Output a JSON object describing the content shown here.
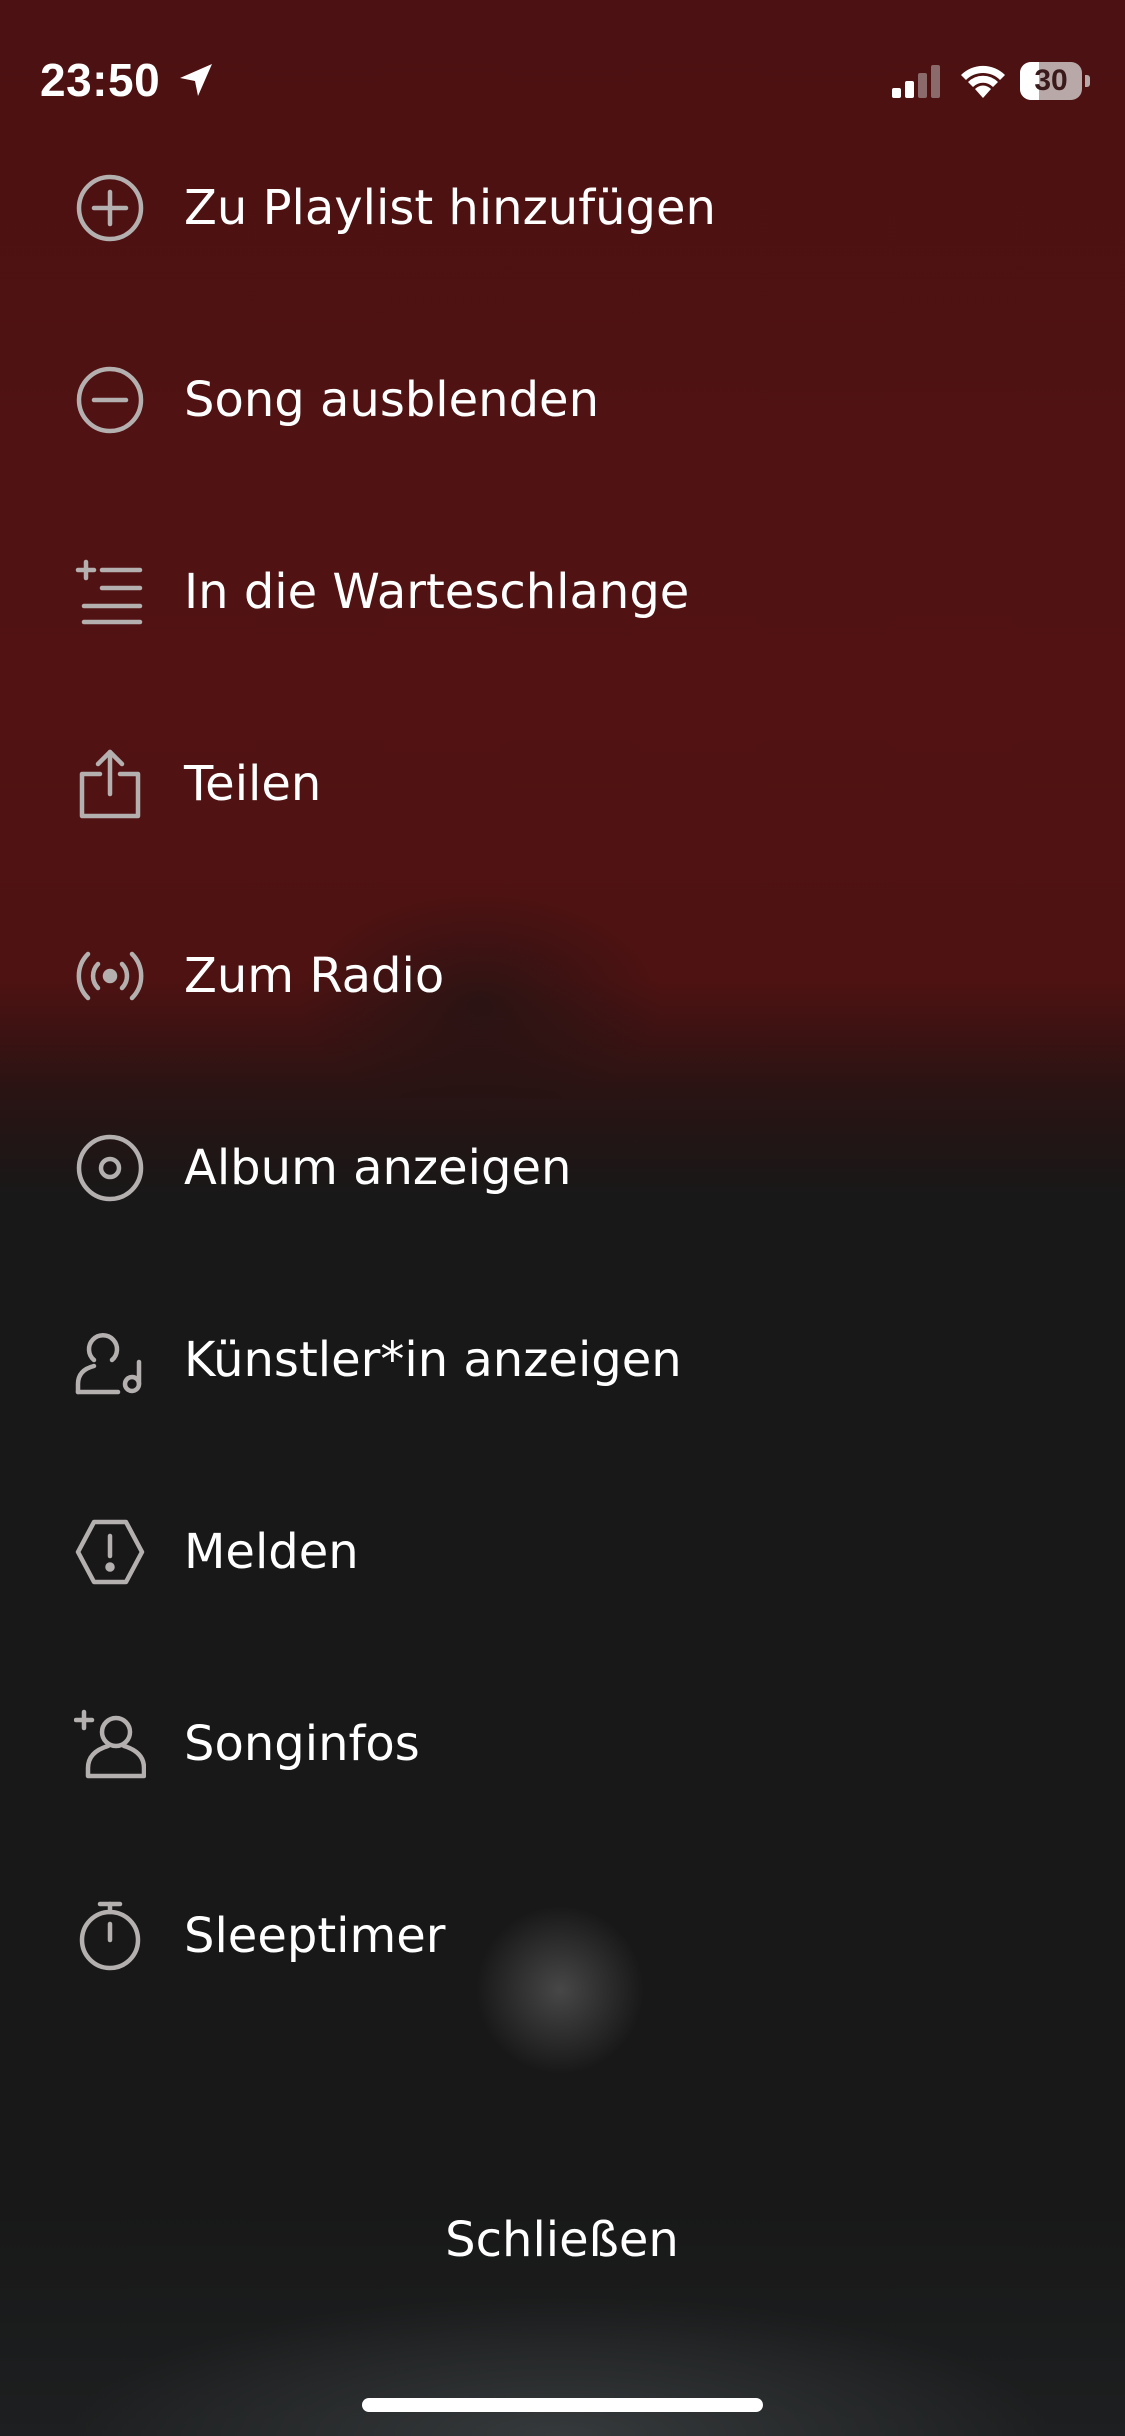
{
  "status_bar": {
    "time": "23:50",
    "battery_level": "30",
    "battery_fraction": 0.3
  },
  "menu": {
    "items": [
      {
        "label": "Zu Playlist hinzufügen",
        "icon": "plus-circle-icon"
      },
      {
        "label": "Song ausblenden",
        "icon": "minus-circle-icon"
      },
      {
        "label": "In die Warteschlange",
        "icon": "add-to-queue-icon"
      },
      {
        "label": "Teilen",
        "icon": "share-icon"
      },
      {
        "label": "Zum Radio",
        "icon": "radio-icon"
      },
      {
        "label": "Album anzeigen",
        "icon": "album-icon"
      },
      {
        "label": "Künstler*in anzeigen",
        "icon": "artist-icon"
      },
      {
        "label": "Melden",
        "icon": "report-icon"
      },
      {
        "label": "Songinfos",
        "icon": "song-credits-icon"
      },
      {
        "label": "Sleeptimer",
        "icon": "timer-icon"
      }
    ]
  },
  "close_label": "Schließen",
  "colors": {
    "accent_top": "#521213",
    "background_bottom": "#181818",
    "text": "#ffffff",
    "icon": "#b5b0b0"
  }
}
